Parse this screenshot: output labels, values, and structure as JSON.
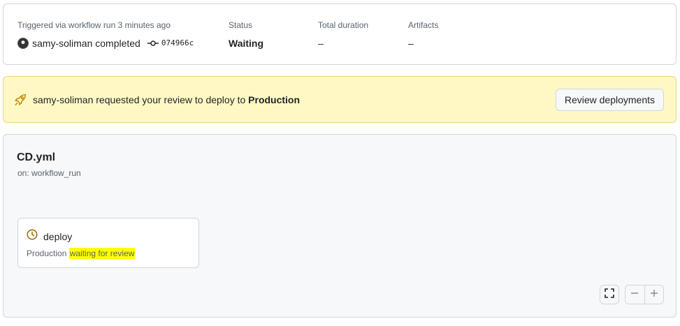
{
  "summary": {
    "trigger_label": "Triggered via workflow run 3 minutes ago",
    "actor": "samy-soliman",
    "action": "completed",
    "commit_sha": "074966c",
    "status_label": "Status",
    "status_value": "Waiting",
    "duration_label": "Total duration",
    "duration_value": "–",
    "artifacts_label": "Artifacts",
    "artifacts_value": "–"
  },
  "banner": {
    "requester": "samy-soliman",
    "message": " requested your review to deploy to ",
    "environment": "Production",
    "button_label": "Review deployments",
    "icon": "rocket-icon",
    "accent": "#bf8700"
  },
  "workflow": {
    "name": "CD.yml",
    "trigger": "on: workflow_run",
    "job": {
      "name": "deploy",
      "icon": "clock-icon",
      "environment": "Production",
      "status_text": "waiting for review"
    }
  },
  "controls": {
    "fullscreen_icon": "fullscreen-icon",
    "zoom_out_icon": "zoom-out-icon",
    "zoom_in_icon": "zoom-in-icon"
  }
}
